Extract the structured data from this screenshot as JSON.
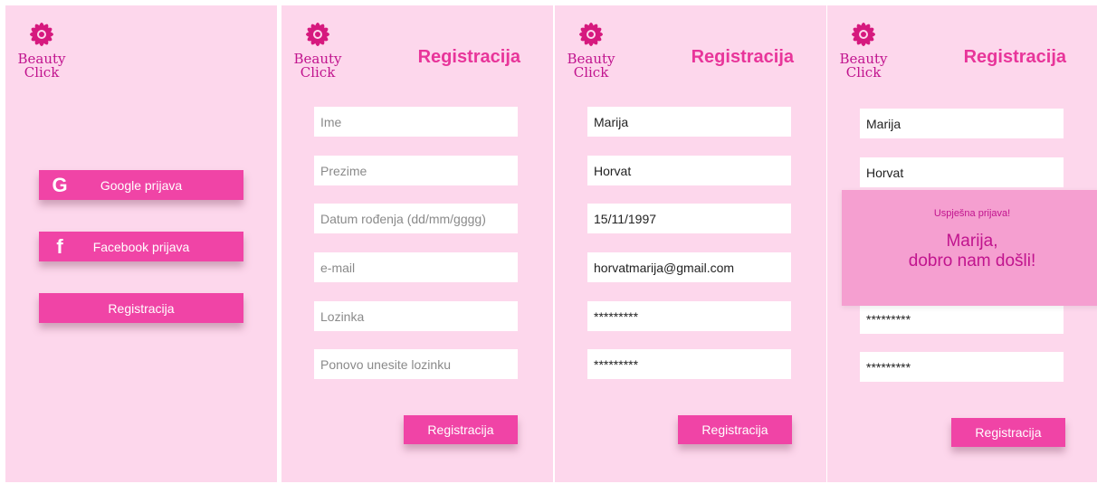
{
  "brand": {
    "line1": "Beauty",
    "line2": "Click",
    "logo_icon": "flower-icon",
    "accent": "#e8359a"
  },
  "screen1": {
    "google_label": "Google prijava",
    "facebook_label": "Facebook prijava",
    "register_label": "Registracija"
  },
  "screen2": {
    "title": "Registracija",
    "placeholders": [
      "Ime",
      "Prezime",
      "Datum rođenja (dd/mm/gggg)",
      "e-mail",
      "Lozinka",
      "Ponovo unesite lozinku"
    ],
    "submit_label": "Registracija"
  },
  "screen3": {
    "title": "Registracija",
    "values": [
      "Marija",
      "Horvat",
      "15/11/1997",
      "horvatmarija@gmail.com",
      "*********",
      "*********"
    ],
    "submit_label": "Registracija"
  },
  "screen4": {
    "title": "Registracija",
    "values": [
      "Marija",
      "Horvat",
      "*********",
      "*********"
    ],
    "popup_small": "Uspješna prijava!",
    "popup_line1": "Marija,",
    "popup_line2": "dobro nam došli!",
    "submit_label": "Registracija"
  }
}
